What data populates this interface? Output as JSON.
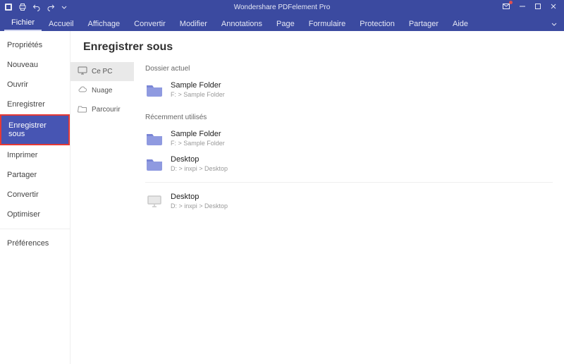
{
  "app": {
    "title": "Wondershare PDFelement Pro"
  },
  "ribbon": {
    "tabs": [
      {
        "label": "Fichier",
        "active": true
      },
      {
        "label": "Accueil"
      },
      {
        "label": "Affichage"
      },
      {
        "label": "Convertir"
      },
      {
        "label": "Modifier"
      },
      {
        "label": "Annotations"
      },
      {
        "label": "Page"
      },
      {
        "label": "Formulaire"
      },
      {
        "label": "Protection"
      },
      {
        "label": "Partager"
      },
      {
        "label": "Aide"
      }
    ]
  },
  "sidebar": {
    "items": [
      {
        "label": "Propriétés"
      },
      {
        "label": "Nouveau"
      },
      {
        "label": "Ouvrir"
      },
      {
        "label": "Enregistrer"
      },
      {
        "label": "Enregistrer sous",
        "selected": true
      },
      {
        "label": "Imprimer"
      },
      {
        "label": "Partager"
      },
      {
        "label": "Convertir"
      },
      {
        "label": "Optimiser"
      }
    ],
    "bottom": [
      {
        "label": "Préférences"
      }
    ]
  },
  "main": {
    "heading": "Enregistrer sous",
    "locations": [
      {
        "label": "Ce PC",
        "icon": "monitor-icon",
        "selected": true
      },
      {
        "label": "Nuage",
        "icon": "cloud-icon"
      },
      {
        "label": "Parcourir",
        "icon": "folder-open-icon"
      }
    ],
    "current_section_label": "Dossier actuel",
    "current_folder": {
      "name": "Sample Folder",
      "path": "F: > Sample Folder"
    },
    "recent_section_label": "Récemment utilisés",
    "recent": [
      {
        "name": "Sample Folder",
        "path": "F: > Sample Folder",
        "icon": "folder"
      },
      {
        "name": "Desktop",
        "path": "D: > inxpi > Desktop",
        "icon": "folder"
      },
      {
        "name": "Desktop",
        "path": "D: > inxpi > Desktop",
        "icon": "monitor"
      }
    ]
  },
  "colors": {
    "accent": "#3b4aa0",
    "folder": "#8f9ae0",
    "highlight": "#e53935"
  }
}
